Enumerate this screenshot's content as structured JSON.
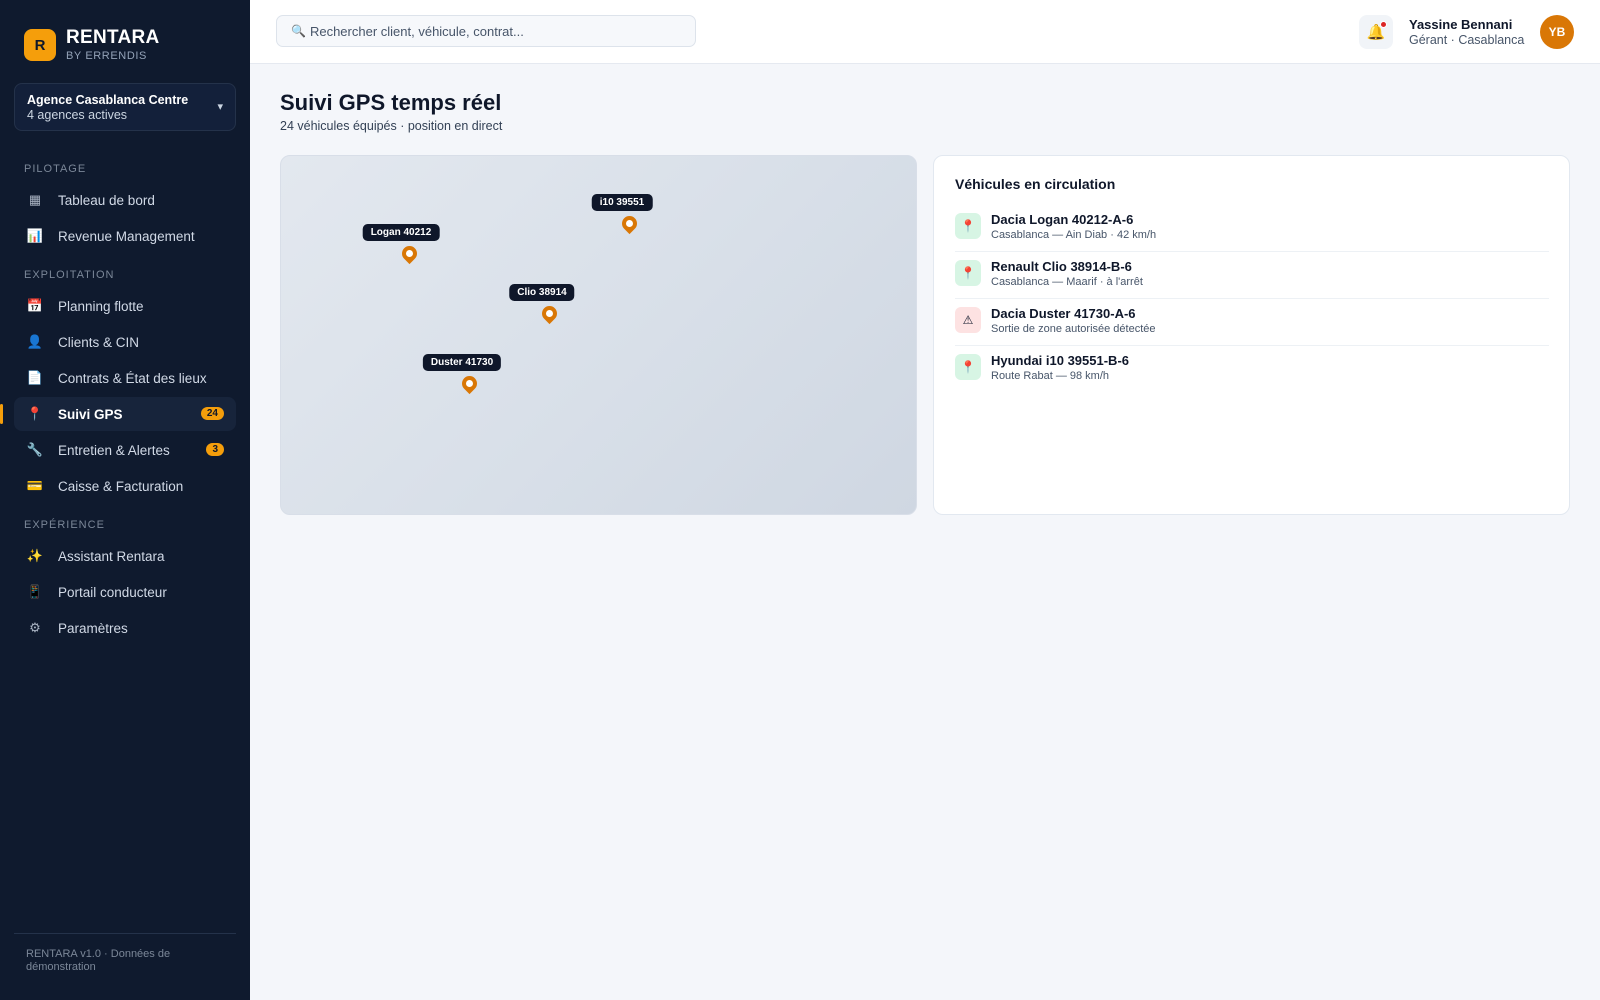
{
  "brand": {
    "logo_letter": "R",
    "name": "RENTARA",
    "subtitle": "BY ERRENDIS",
    "accent": "#f59e0b"
  },
  "agency_selector": {
    "name": "Agence Casablanca Centre",
    "sub": "4 agences actives",
    "caret": "▾"
  },
  "sidebar": {
    "sections": [
      {
        "title": "PILOTAGE"
      },
      {
        "title": "EXPLOITATION"
      },
      {
        "title": "EXPÉRIENCE"
      }
    ],
    "items": [
      {
        "icon": "▦",
        "icon_name": "dashboard-icon",
        "label": "Tableau de bord"
      },
      {
        "icon": "📊",
        "icon_name": "bar-chart-icon",
        "label": "Revenue Management"
      },
      {
        "icon": "📅",
        "icon_name": "calendar-icon",
        "label": "Planning flotte"
      },
      {
        "icon": "👤",
        "icon_name": "user-icon",
        "label": "Clients & CIN"
      },
      {
        "icon": "📄",
        "icon_name": "document-icon",
        "label": "Contrats & État des lieux"
      },
      {
        "icon": "📍",
        "icon_name": "map-pin-icon",
        "label": "Suivi GPS",
        "badge": "24",
        "active": true
      },
      {
        "icon": "🔧",
        "icon_name": "wrench-icon",
        "label": "Entretien & Alertes",
        "badge": "3"
      },
      {
        "icon": "💳",
        "icon_name": "credit-card-icon",
        "label": "Caisse & Facturation"
      },
      {
        "icon": "✨",
        "icon_name": "sparkles-icon",
        "label": "Assistant Rentara"
      },
      {
        "icon": "📱",
        "icon_name": "mobile-icon",
        "label": "Portail conducteur"
      },
      {
        "icon": "⚙",
        "icon_name": "gear-icon",
        "label": "Paramètres"
      }
    ],
    "footer": "RENTARA v1.0 · Données de démonstration"
  },
  "header": {
    "search_placeholder": "Rechercher client, véhicule, contrat...",
    "search_icon": "🔍",
    "bell_icon": "🔔",
    "user_name": "Yassine Bennani",
    "user_role": "Gérant · Casablanca",
    "avatar_initials": "YB"
  },
  "page": {
    "title": "Suivi GPS temps réel",
    "subtitle": "24 véhicules équipés · position en direct"
  },
  "map": {
    "markers": [
      {
        "label": "Logan 40212"
      },
      {
        "label": "i10 39551"
      },
      {
        "label": "Clio 38914"
      },
      {
        "label": "Duster 41730"
      }
    ]
  },
  "vehicles_panel": {
    "title": "Véhicules en circulation",
    "items": [
      {
        "name": "Dacia Logan 40212-A-6",
        "detail": "Casablanca — Ain Diab · 42 km/h",
        "status": "ok",
        "icon": "📍",
        "icon_name": "map-pin-icon"
      },
      {
        "name": "Renault Clio 38914-B-6",
        "detail": "Casablanca — Maarif · à l'arrêt",
        "status": "ok",
        "icon": "📍",
        "icon_name": "map-pin-icon"
      },
      {
        "name": "Dacia Duster 41730-A-6",
        "detail": "Sortie de zone autorisée détectée",
        "status": "warn",
        "icon": "⚠",
        "icon_name": "warning-icon"
      },
      {
        "name": "Hyundai i10 39551-B-6",
        "detail": "Route Rabat — 98 km/h",
        "status": "ok",
        "icon": "📍",
        "icon_name": "map-pin-icon"
      }
    ]
  }
}
